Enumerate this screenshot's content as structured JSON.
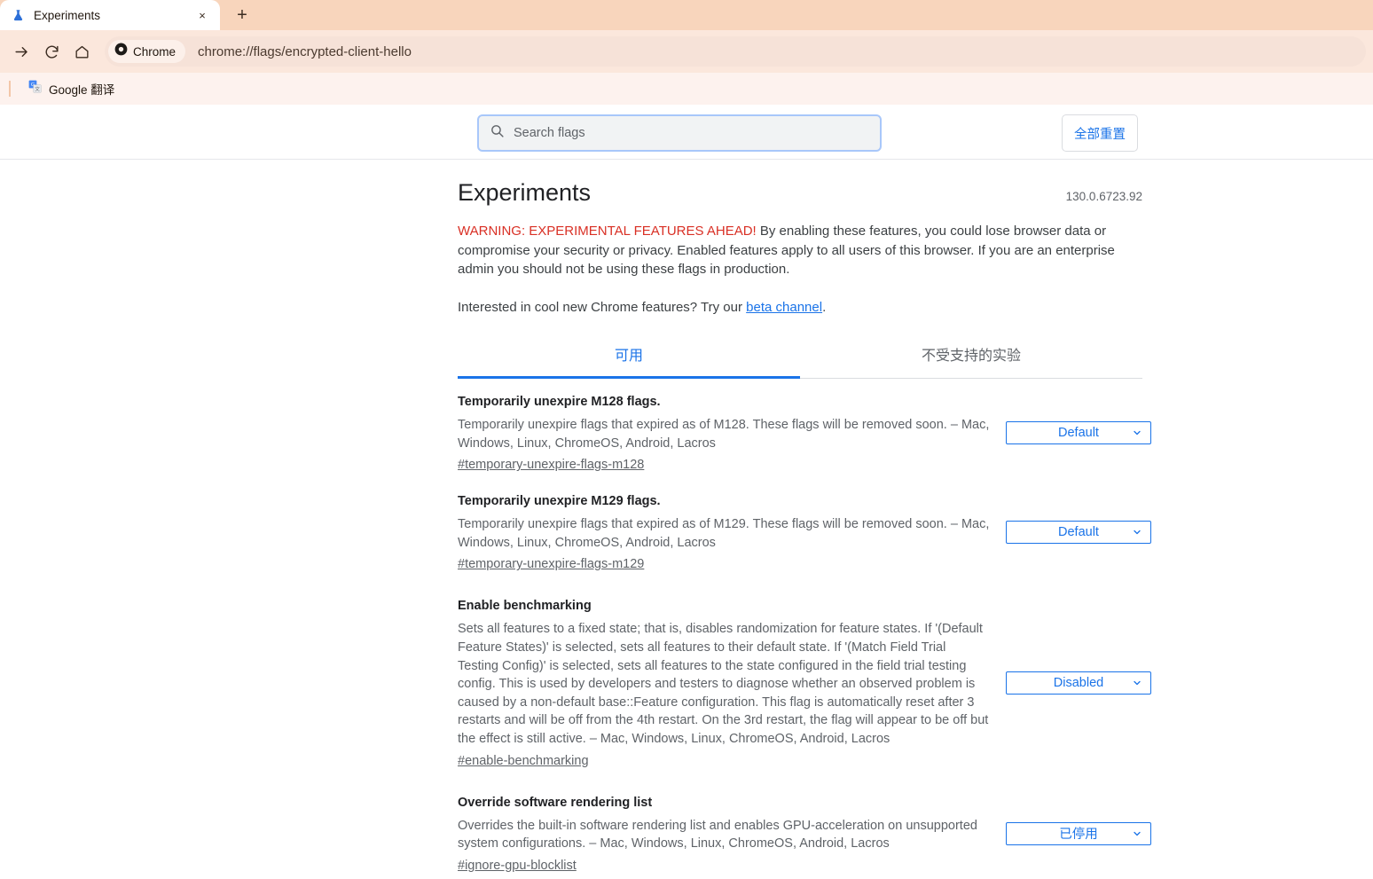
{
  "browser": {
    "tab": {
      "title": "Experiments",
      "favicon": "flask-icon",
      "close": "×"
    },
    "new_tab_label": "+",
    "toolbar": {
      "forward_icon": "forward-arrow-icon",
      "reload_icon": "reload-icon",
      "home_icon": "home-icon",
      "chip_label": "Chrome",
      "chip_icon": "chrome-logo-icon",
      "url": "chrome://flags/encrypted-client-hello"
    },
    "bookmarks": [
      {
        "label": "Google 翻译",
        "icon": "google-translate-icon"
      }
    ]
  },
  "flags_header": {
    "search": {
      "placeholder": "Search flags",
      "value": "",
      "icon": "search-icon"
    },
    "reset_all_label": "全部重置"
  },
  "page": {
    "title": "Experiments",
    "version": "130.0.6723.92",
    "warning_strong": "WARNING: EXPERIMENTAL FEATURES AHEAD!",
    "warning_body": " By enabling these features, you could lose browser data or compromise your security or privacy. Enabled features apply to all users of this browser. If you are an enterprise admin you should not be using these flags in production.",
    "beta_prefix": "Interested in cool new Chrome features? Try our ",
    "beta_link": "beta channel",
    "beta_suffix": ".",
    "tabs": [
      {
        "label": "可用",
        "active": true
      },
      {
        "label": "不受支持的实验",
        "active": false
      }
    ],
    "flags": [
      {
        "name": "Temporarily unexpire M128 flags.",
        "description": "Temporarily unexpire flags that expired as of M128. These flags will be removed soon. – Mac, Windows, Linux, ChromeOS, Android, Lacros",
        "anchor": "#temporary-unexpire-flags-m128",
        "select_value": "Default"
      },
      {
        "name": "Temporarily unexpire M129 flags.",
        "description": "Temporarily unexpire flags that expired as of M129. These flags will be removed soon. – Mac, Windows, Linux, ChromeOS, Android, Lacros",
        "anchor": "#temporary-unexpire-flags-m129",
        "select_value": "Default"
      },
      {
        "name": "Enable benchmarking",
        "description": "Sets all features to a fixed state; that is, disables randomization for feature states. If '(Default Feature States)' is selected, sets all features to their default state. If '(Match Field Trial Testing Config)' is selected, sets all features to the state configured in the field trial testing config. This is used by developers and testers to diagnose whether an observed problem is caused by a non-default base::Feature configuration. This flag is automatically reset after 3 restarts and will be off from the 4th restart. On the 3rd restart, the flag will appear to be off but the effect is still active. – Mac, Windows, Linux, ChromeOS, Android, Lacros",
        "anchor": "#enable-benchmarking",
        "select_value": "Disabled"
      },
      {
        "name": "Override software rendering list",
        "description": "Overrides the built-in software rendering list and enables GPU-acceleration on unsupported system configurations. – Mac, Windows, Linux, ChromeOS, Android, Lacros",
        "anchor": "#ignore-gpu-blocklist",
        "select_value": "已停用"
      }
    ]
  },
  "colors": {
    "accent_blue": "#1a73e8",
    "warning_red": "#d93025",
    "tabstrip_bg": "#f8d5bc",
    "toolbar_bg": "#fbe7dc",
    "bookmark_bg": "#fdf2ee"
  }
}
